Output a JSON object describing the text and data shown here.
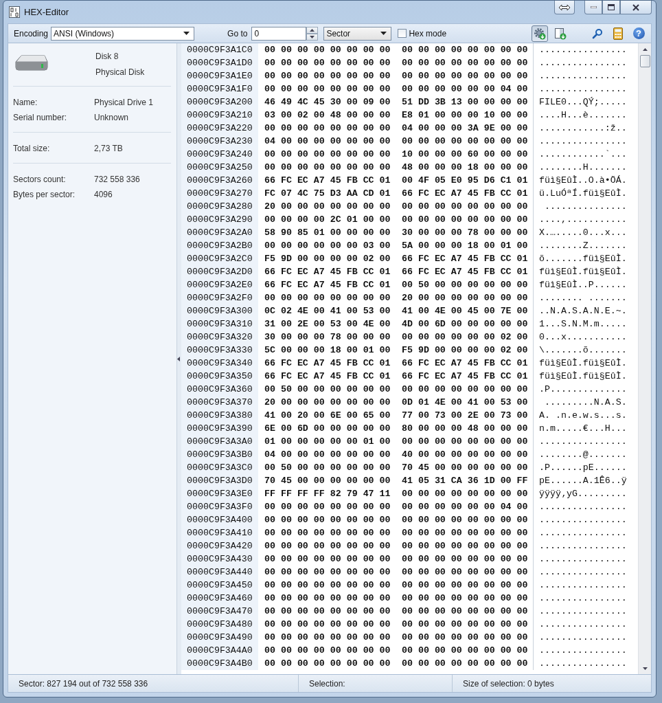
{
  "window": {
    "title": "HEX-Editor"
  },
  "toolbar": {
    "encoding_label": "Encoding",
    "encoding_value": "ANSI (Windows)",
    "goto_label": "Go to",
    "goto_value": "0",
    "unit_value": "Sector",
    "hex_mode": {
      "label": "Hex mode",
      "checked": false
    },
    "tools": [
      {
        "kind": "gear",
        "selected": true
      },
      {
        "kind": "panel",
        "selected": false
      },
      {
        "kind": "search",
        "selected": false
      },
      {
        "kind": "calculator",
        "selected": false
      },
      {
        "kind": "help",
        "selected": false,
        "glyph": "?"
      }
    ]
  },
  "disk": {
    "name": "Disk 8",
    "type": "Physical Disk"
  },
  "property_groups": [
    {
      "items": [
        {
          "label": "Name:",
          "value": "Physical Drive 1"
        },
        {
          "label": "Serial number:",
          "value": "Unknown"
        }
      ]
    },
    {
      "items": [
        {
          "label": "Total size:",
          "value": "2,73 TB"
        }
      ]
    },
    {
      "items": [
        {
          "label": "Sectors count:",
          "value": "732 558 336"
        },
        {
          "label": "Bytes per sector:",
          "value": "4096"
        }
      ]
    }
  ],
  "hex_view": {
    "rows": [
      {
        "offset": "0000C9F3A1C0",
        "hex_left": "00 00 00 00 00 00 00 00",
        "hex_right": "00 00 00 00 00 00 00 00",
        "ascii": "................"
      },
      {
        "offset": "0000C9F3A1D0",
        "hex_left": "00 00 00 00 00 00 00 00",
        "hex_right": "00 00 00 00 00 00 00 00",
        "ascii": "................"
      },
      {
        "offset": "0000C9F3A1E0",
        "hex_left": "00 00 00 00 00 00 00 00",
        "hex_right": "00 00 00 00 00 00 00 00",
        "ascii": "................"
      },
      {
        "offset": "0000C9F3A1F0",
        "hex_left": "00 00 00 00 00 00 00 00",
        "hex_right": "00 00 00 00 00 00 04 00",
        "ascii": "................"
      },
      {
        "offset": "0000C9F3A200",
        "hex_left": "46 49 4C 45 30 00 09 00",
        "hex_right": "51 DD 3B 13 00 00 00 00",
        "ascii": "FILE0...QÝ;....."
      },
      {
        "offset": "0000C9F3A210",
        "hex_left": "03 00 02 00 48 00 00 00",
        "hex_right": "E8 01 00 00 00 10 00 00",
        "ascii": "....H...è......."
      },
      {
        "offset": "0000C9F3A220",
        "hex_left": "00 00 00 00 00 00 00 00",
        "hex_right": "04 00 00 00 3A 9E 00 00",
        "ascii": "............:ž.."
      },
      {
        "offset": "0000C9F3A230",
        "hex_left": "04 00 00 00 00 00 00 00",
        "hex_right": "00 00 00 00 00 00 00 00",
        "ascii": "................"
      },
      {
        "offset": "0000C9F3A240",
        "hex_left": "00 00 00 00 00 00 00 00",
        "hex_right": "10 00 00 00 60 00 00 00",
        "ascii": "............`..."
      },
      {
        "offset": "0000C9F3A250",
        "hex_left": "00 00 00 00 00 00 00 00",
        "hex_right": "48 00 00 00 18 00 00 00",
        "ascii": "........H......."
      },
      {
        "offset": "0000C9F3A260",
        "hex_left": "66 FC EC A7 45 FB CC 01",
        "hex_right": "00 4F 05 E0 95 D6 C1 01",
        "ascii": "füì§EûÌ..O.à•ÖÁ."
      },
      {
        "offset": "0000C9F3A270",
        "hex_left": "FC 07 4C 75 D3 AA CD 01",
        "hex_right": "66 FC EC A7 45 FB CC 01",
        "ascii": "ü.LuÓªÍ.füì§EûÌ."
      },
      {
        "offset": "0000C9F3A280",
        "hex_left": "20 00 00 00 00 00 00 00",
        "hex_right": "00 00 00 00 00 00 00 00",
        "ascii": " ..............."
      },
      {
        "offset": "0000C9F3A290",
        "hex_left": "00 00 00 00 2C 01 00 00",
        "hex_right": "00 00 00 00 00 00 00 00",
        "ascii": "....,..........."
      },
      {
        "offset": "0000C9F3A2A0",
        "hex_left": "58 90 85 01 00 00 00 00",
        "hex_right": "30 00 00 00 78 00 00 00",
        "ascii": "X.….....0...x..."
      },
      {
        "offset": "0000C9F3A2B0",
        "hex_left": "00 00 00 00 00 00 03 00",
        "hex_right": "5A 00 00 00 18 00 01 00",
        "ascii": "........Z......."
      },
      {
        "offset": "0000C9F3A2C0",
        "hex_left": "F5 9D 00 00 00 00 02 00",
        "hex_right": "66 FC EC A7 45 FB CC 01",
        "ascii": "õ.......füì§EûÌ."
      },
      {
        "offset": "0000C9F3A2D0",
        "hex_left": "66 FC EC A7 45 FB CC 01",
        "hex_right": "66 FC EC A7 45 FB CC 01",
        "ascii": "füì§EûÌ.füì§EûÌ."
      },
      {
        "offset": "0000C9F3A2E0",
        "hex_left": "66 FC EC A7 45 FB CC 01",
        "hex_right": "00 50 00 00 00 00 00 00",
        "ascii": "füì§EûÌ..P......"
      },
      {
        "offset": "0000C9F3A2F0",
        "hex_left": "00 00 00 00 00 00 00 00",
        "hex_right": "20 00 00 00 00 00 00 00",
        "ascii": "........ ......."
      },
      {
        "offset": "0000C9F3A300",
        "hex_left": "0C 02 4E 00 41 00 53 00",
        "hex_right": "41 00 4E 00 45 00 7E 00",
        "ascii": "..N.A.S.A.N.E.~."
      },
      {
        "offset": "0000C9F3A310",
        "hex_left": "31 00 2E 00 53 00 4E 00",
        "hex_right": "4D 00 6D 00 00 00 00 00",
        "ascii": "1...S.N.M.m....."
      },
      {
        "offset": "0000C9F3A320",
        "hex_left": "30 00 00 00 78 00 00 00",
        "hex_right": "00 00 00 00 00 00 02 00",
        "ascii": "0...x..........."
      },
      {
        "offset": "0000C9F3A330",
        "hex_left": "5C 00 00 00 18 00 01 00",
        "hex_right": "F5 9D 00 00 00 00 02 00",
        "ascii": "\\.......õ......."
      },
      {
        "offset": "0000C9F3A340",
        "hex_left": "66 FC EC A7 45 FB CC 01",
        "hex_right": "66 FC EC A7 45 FB CC 01",
        "ascii": "füì§EûÌ.füì§EûÌ."
      },
      {
        "offset": "0000C9F3A350",
        "hex_left": "66 FC EC A7 45 FB CC 01",
        "hex_right": "66 FC EC A7 45 FB CC 01",
        "ascii": "füì§EûÌ.füì§EûÌ."
      },
      {
        "offset": "0000C9F3A360",
        "hex_left": "00 50 00 00 00 00 00 00",
        "hex_right": "00 00 00 00 00 00 00 00",
        "ascii": ".P.............."
      },
      {
        "offset": "0000C9F3A370",
        "hex_left": "20 00 00 00 00 00 00 00",
        "hex_right": "0D 01 4E 00 41 00 53 00",
        "ascii": " .........N.A.S."
      },
      {
        "offset": "0000C9F3A380",
        "hex_left": "41 00 20 00 6E 00 65 00",
        "hex_right": "77 00 73 00 2E 00 73 00",
        "ascii": "A. .n.e.w.s...s."
      },
      {
        "offset": "0000C9F3A390",
        "hex_left": "6E 00 6D 00 00 00 00 00",
        "hex_right": "80 00 00 00 48 00 00 00",
        "ascii": "n.m.....€...H..."
      },
      {
        "offset": "0000C9F3A3A0",
        "hex_left": "01 00 00 00 00 00 01 00",
        "hex_right": "00 00 00 00 00 00 00 00",
        "ascii": "................"
      },
      {
        "offset": "0000C9F3A3B0",
        "hex_left": "04 00 00 00 00 00 00 00",
        "hex_right": "40 00 00 00 00 00 00 00",
        "ascii": "........@......."
      },
      {
        "offset": "0000C9F3A3C0",
        "hex_left": "00 50 00 00 00 00 00 00",
        "hex_right": "70 45 00 00 00 00 00 00",
        "ascii": ".P......pE......"
      },
      {
        "offset": "0000C9F3A3D0",
        "hex_left": "70 45 00 00 00 00 00 00",
        "hex_right": "41 05 31 CA 36 1D 00 FF",
        "ascii": "pE......A.1Ê6..ÿ"
      },
      {
        "offset": "0000C9F3A3E0",
        "hex_left": "FF FF FF FF 82 79 47 11",
        "hex_right": "00 00 00 00 00 00 00 00",
        "ascii": "ÿÿÿÿ‚yG........."
      },
      {
        "offset": "0000C9F3A3F0",
        "hex_left": "00 00 00 00 00 00 00 00",
        "hex_right": "00 00 00 00 00 00 04 00",
        "ascii": "................"
      },
      {
        "offset": "0000C9F3A400",
        "hex_left": "00 00 00 00 00 00 00 00",
        "hex_right": "00 00 00 00 00 00 00 00",
        "ascii": "................"
      },
      {
        "offset": "0000C9F3A410",
        "hex_left": "00 00 00 00 00 00 00 00",
        "hex_right": "00 00 00 00 00 00 00 00",
        "ascii": "................"
      },
      {
        "offset": "0000C9F3A420",
        "hex_left": "00 00 00 00 00 00 00 00",
        "hex_right": "00 00 00 00 00 00 00 00",
        "ascii": "................"
      },
      {
        "offset": "0000C9F3A430",
        "hex_left": "00 00 00 00 00 00 00 00",
        "hex_right": "00 00 00 00 00 00 00 00",
        "ascii": "................"
      },
      {
        "offset": "0000C9F3A440",
        "hex_left": "00 00 00 00 00 00 00 00",
        "hex_right": "00 00 00 00 00 00 00 00",
        "ascii": "................"
      },
      {
        "offset": "0000C9F3A450",
        "hex_left": "00 00 00 00 00 00 00 00",
        "hex_right": "00 00 00 00 00 00 00 00",
        "ascii": "................"
      },
      {
        "offset": "0000C9F3A460",
        "hex_left": "00 00 00 00 00 00 00 00",
        "hex_right": "00 00 00 00 00 00 00 00",
        "ascii": "................"
      },
      {
        "offset": "0000C9F3A470",
        "hex_left": "00 00 00 00 00 00 00 00",
        "hex_right": "00 00 00 00 00 00 00 00",
        "ascii": "................"
      },
      {
        "offset": "0000C9F3A480",
        "hex_left": "00 00 00 00 00 00 00 00",
        "hex_right": "00 00 00 00 00 00 00 00",
        "ascii": "................"
      },
      {
        "offset": "0000C9F3A490",
        "hex_left": "00 00 00 00 00 00 00 00",
        "hex_right": "00 00 00 00 00 00 00 00",
        "ascii": "................"
      },
      {
        "offset": "0000C9F3A4A0",
        "hex_left": "00 00 00 00 00 00 00 00",
        "hex_right": "00 00 00 00 00 00 00 00",
        "ascii": "................"
      },
      {
        "offset": "0000C9F3A4B0",
        "hex_left": "00 00 00 00 00 00 00 00",
        "hex_right": "00 00 00 00 00 00 00 00",
        "ascii": "................"
      }
    ]
  },
  "status_bar": [
    "Sector: 827 194 out of 732 558 336",
    "Selection:",
    "Size of selection: 0 bytes"
  ]
}
